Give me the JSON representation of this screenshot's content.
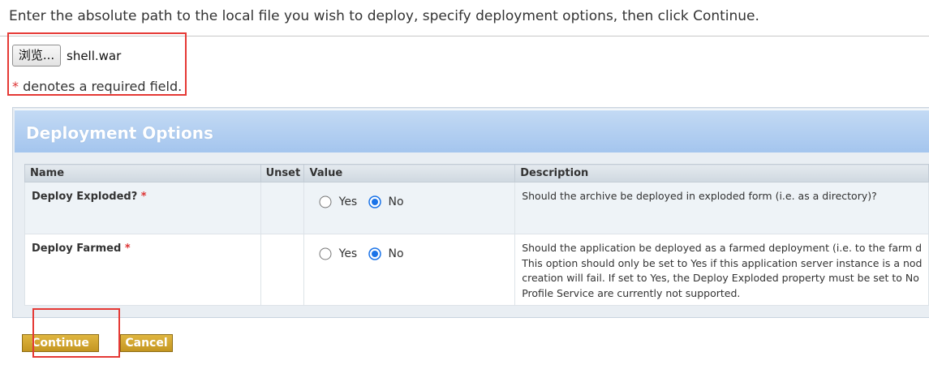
{
  "instruction": "Enter the absolute path to the local file you wish to deploy, specify deployment options, then click Continue.",
  "file_input": {
    "browse_label": "浏览...",
    "file_name": "shell.war"
  },
  "required_note": {
    "star": "*",
    "text": "denotes a required field."
  },
  "panel": {
    "title": "Deployment Options"
  },
  "table": {
    "headers": [
      "Name",
      "Unset",
      "Value",
      "Description"
    ],
    "rows": [
      {
        "name": "Deploy Exploded?",
        "star": "*",
        "unset": "",
        "yes_label": "Yes",
        "no_label": "No",
        "selected": "No",
        "description_lines": [
          "Should the archive be deployed in exploded form (i.e. as a directory)?"
        ]
      },
      {
        "name": "Deploy Farmed",
        "star": "*",
        "unset": "",
        "yes_label": "Yes",
        "no_label": "No",
        "selected": "No",
        "description_lines": [
          "Should the application be deployed as a farmed deployment (i.e. to the farm d",
          "This option should only be set to Yes if this application server instance is a nod",
          "creation will fail. If set to Yes, the Deploy Exploded property must be set to No",
          "Profile Service are currently not supported."
        ]
      }
    ]
  },
  "buttons": {
    "continue": "Continue",
    "cancel": "Cancel"
  },
  "colors": {
    "annotation_red": "#e53935",
    "button_gold": "#c9a02a",
    "required_star": "#dd3333",
    "radio_selected": "#1a73e8"
  }
}
